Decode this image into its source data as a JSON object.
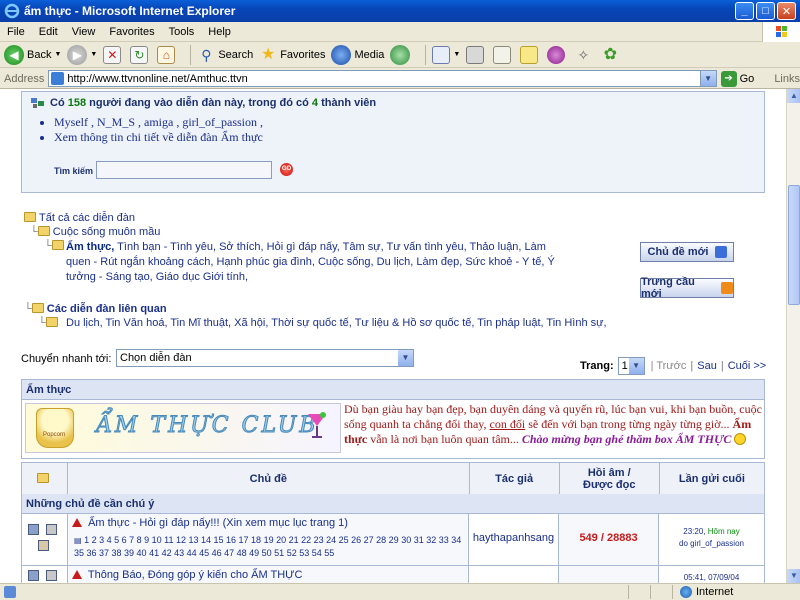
{
  "window": {
    "title": "ẩm thực - Microsoft Internet Explorer",
    "minimize": "_",
    "maximize": "□",
    "close": "✕"
  },
  "menu": [
    "File",
    "Edit",
    "View",
    "Favorites",
    "Tools",
    "Help"
  ],
  "toolbar": {
    "back": "Back",
    "search": "Search",
    "favorites": "Favorites",
    "media": "Media",
    "icons": [
      "back-icon",
      "forward-icon",
      "stop-icon",
      "refresh-icon",
      "home-icon",
      "search-icon",
      "favorites-star-icon",
      "media-icon",
      "history-icon",
      "mail-icon",
      "print-icon",
      "edit-icon",
      "discuss-icon",
      "messenger-icon",
      "research-icon",
      "flower-icon"
    ]
  },
  "address": {
    "label": "Address",
    "url": "http://www.ttvnonline.net/Amthuc.ttvn",
    "go": "Go",
    "links": "Links"
  },
  "online": {
    "prefix": "Có",
    "count": "158",
    "middle": "người đang vào diễn đàn này, trong đó có",
    "members": "4",
    "suffix": "thành viên",
    "users_line": "Myself , N_M_S , amiga , girl_of_passion ,",
    "details_link": "Xem thông tin chi tiết về diễn đàn Ẩm thực",
    "search_label": "Tìm kiếm",
    "search_value": "",
    "go_label": "GO"
  },
  "tree": {
    "all": "Tất cả các diễn đàn",
    "life": "Cuộc sống muôn mầu",
    "current": "Ẩm thực,",
    "siblings": "Tình bạn - Tình yêu, Sở thích, Hỏi gì đáp nấy, Tâm sự, Tư vấn tình yêu, Thảo luận, Làm quen - Rút ngắn khoảng cách, Hạnh phúc gia đình, Cuộc sống, Du lịch, Làm đẹp, Sức khoẻ - Y tế, Ý tưởng - Sáng tạo, Giáo dục Giới tính,",
    "related_title": "Các diễn đàn liên quan",
    "related": "Du lịch, Tin Văn hoá, Tin Mĩ thuật, Xã hội, Thời sự quốc tế, Tư liệu & Hồ sơ quốc tế, Tin pháp luật, Tin Hình sự,"
  },
  "buttons": {
    "new_topic": "Chủ đề mới",
    "new_poll": "Trưng cầu mới"
  },
  "quick_jump": {
    "label": "Chuyển nhanh tới:",
    "selected": "Chọn diễn đàn"
  },
  "pager": {
    "label": "Trang:",
    "current": "1",
    "prev": "| Trước",
    "next": "Sau",
    "last": "Cuối >>"
  },
  "forum_box": {
    "title": "Ẩm thực",
    "banner_text": "ẨM THỰC CLUB",
    "popcorn_label": "Popcorn",
    "desc_part1": "Dù bạn giàu hay bạn đẹp, bạn duyên dáng và quyến rũ, lúc bạn vui, khi bạn buồn, cuộc sống quanh ta chẳng đổi thay,",
    "desc_link": "con đối",
    "desc_part2": "sẽ đến với bạn trong từng ngày từng giờ...",
    "desc_bold": "Ẩm thực",
    "desc_part3": "vẫn là nơi bạn luôn quan tâm...",
    "welcome": "Chào mừng bạn ghé thăm box ẨM THỰC"
  },
  "table": {
    "headers": {
      "topic": "Chủ đề",
      "author": "Tác giả",
      "replies_line1": "Hồi âm /",
      "replies_line2": "Được đọc",
      "last": "Lần gửi cuối"
    },
    "sticky_label": "Những chủ đề cần chú ý",
    "rows": [
      {
        "title": "Ẩm thực - Hỏi gì đáp nấy!!! (Xin xem mục lục trang 1)",
        "pages_line1": "1 2 3 4 5 6 7 8 9 10 11 12 13 14 15 16 17 18 19 20 21 22 23 24 25 26 27 28 29 30 31 32 33 34",
        "pages_line2": "35 36 37 38 39 40 41 42 43 44 45 46 47 48 49 50 51 52 53 54 55",
        "author": "haythapanhsang",
        "replies": "549",
        "views": "28883",
        "last_time": "23:20,",
        "last_day": "Hôm nay",
        "last_by": "do girl_of_passion"
      },
      {
        "title": "Thông Báo, Đóng góp ý kiến cho ẨM THỰC",
        "pages_line1": "",
        "pages_line2": "",
        "author": "",
        "replies": "",
        "views": "",
        "last_time": "05:41, 07/09/04",
        "last_day": "",
        "last_by": ""
      }
    ]
  },
  "status": {
    "zone": "Internet"
  },
  "colors": {
    "titlebar": "#0a5fd8",
    "link": "#1a2f8a",
    "accent_red": "#c81a1a",
    "panel_border": "#a9b8d4"
  }
}
